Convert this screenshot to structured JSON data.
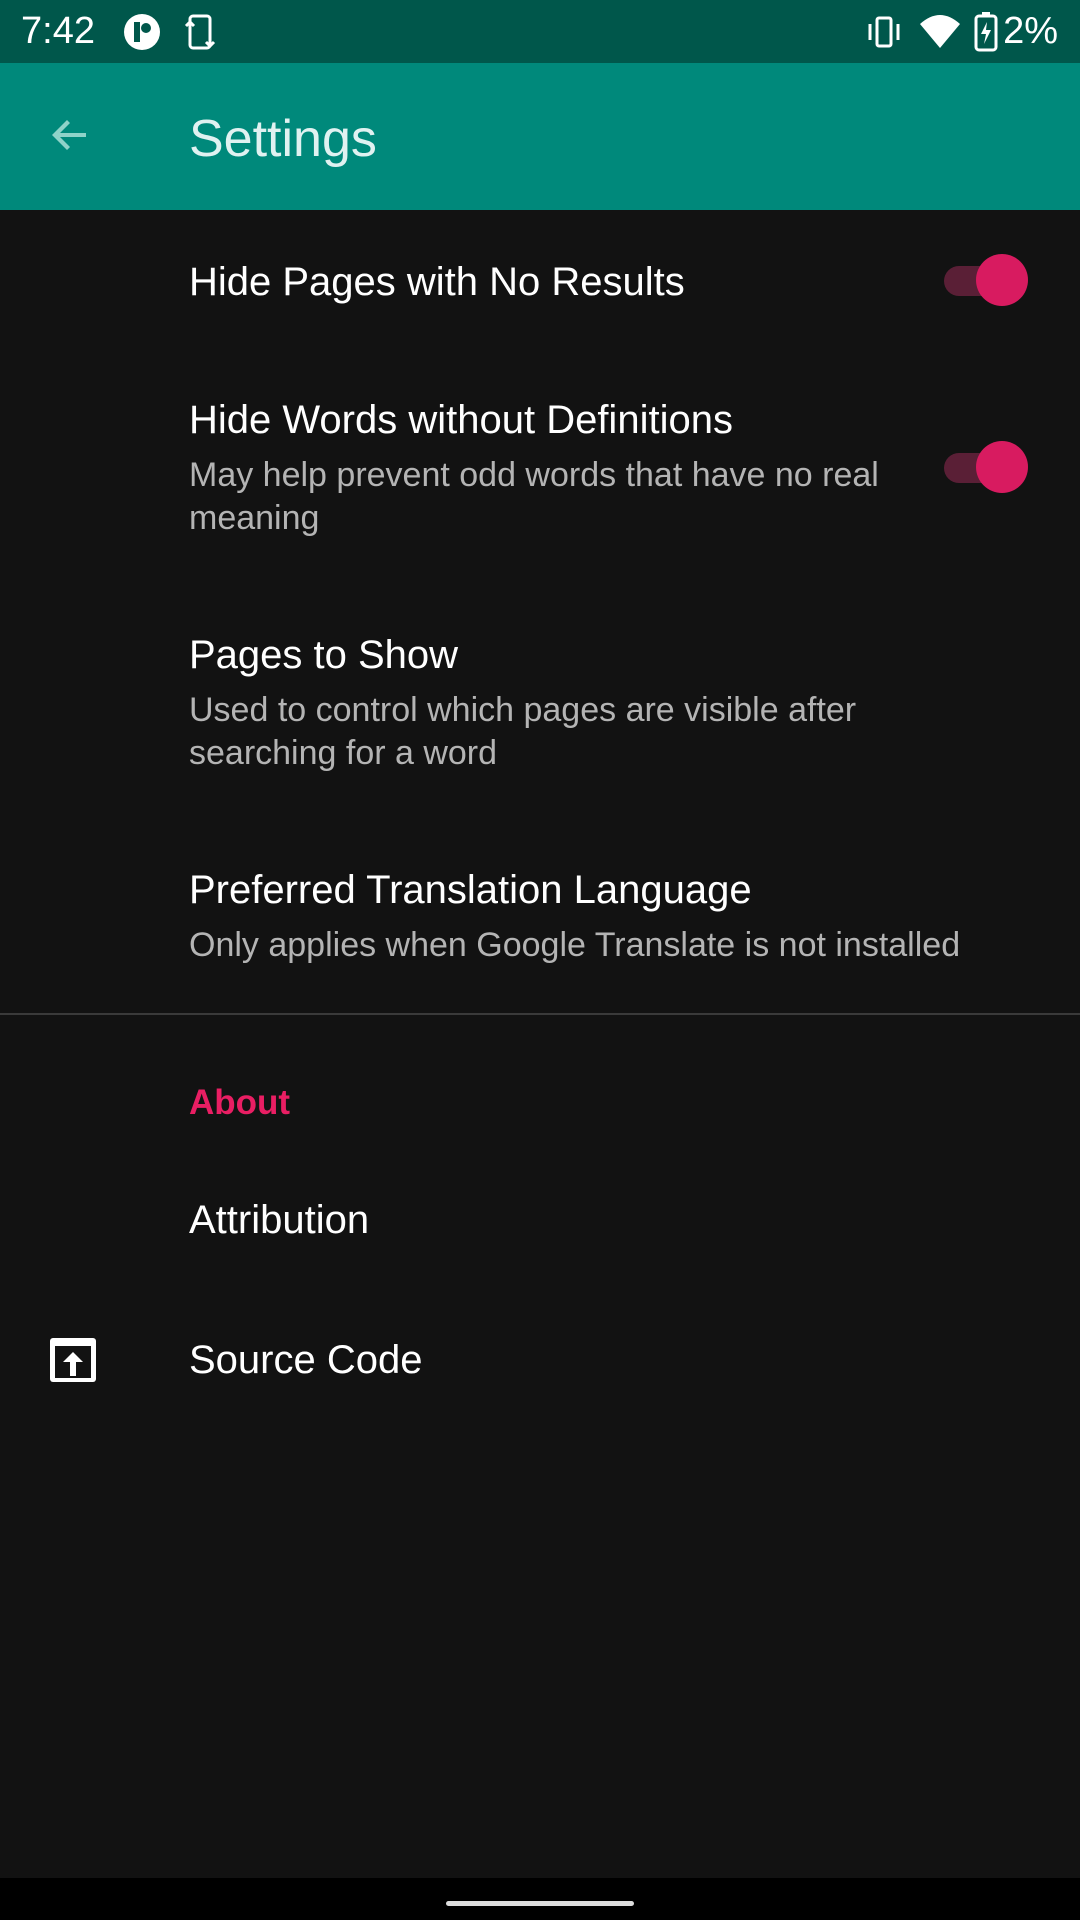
{
  "status_bar": {
    "time": "7:42",
    "battery_pct": "2%",
    "icons": [
      "app-notification-icon",
      "screen-rotate-icon",
      "vibrate-icon",
      "wifi-icon",
      "battery-charging-icon"
    ]
  },
  "app_bar": {
    "title": "Settings",
    "back_icon": "arrow-back-icon",
    "color": "#00897b"
  },
  "preferences": [
    {
      "title": "Hide Pages with No Results",
      "summary": "",
      "switch_on": true
    },
    {
      "title": "Hide Words without Definitions",
      "summary": "May help prevent odd words that have no real meaning",
      "switch_on": true
    },
    {
      "title": "Pages to Show",
      "summary": "Used to control which pages are visible after searching for a word"
    },
    {
      "title": "Preferred Translation Language",
      "summary": "Only applies when Google Translate is not installed"
    }
  ],
  "about": {
    "category": "About",
    "items": [
      {
        "title": "Attribution"
      },
      {
        "title": "Source Code",
        "icon": "open-in-browser-icon"
      }
    ]
  },
  "colors": {
    "accent": "#e91e63",
    "status_bar": "#00574b",
    "background": "#121212"
  }
}
